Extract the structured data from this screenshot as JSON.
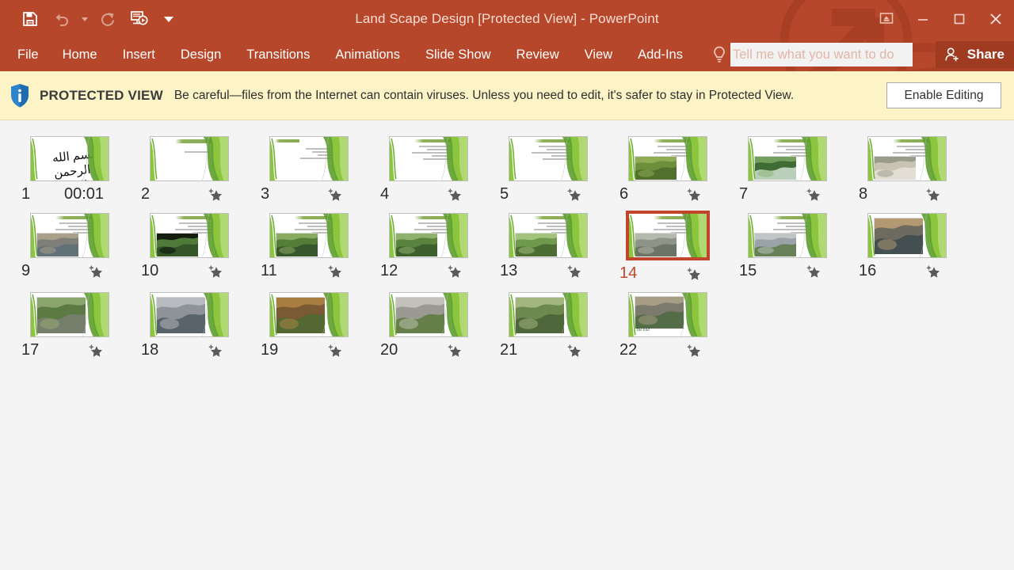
{
  "window": {
    "title": "Land Scape Design [Protected View] - PowerPoint",
    "titlebar_color": "#B7472A",
    "accent_color": "#C0452A"
  },
  "quick_access": {
    "items": [
      {
        "name": "save-icon",
        "label": "Save",
        "enabled": true
      },
      {
        "name": "undo-icon",
        "label": "Undo",
        "enabled": false
      },
      {
        "name": "redo-icon",
        "label": "Redo",
        "enabled": false
      },
      {
        "name": "start-from-beginning-icon",
        "label": "Start From Beginning",
        "enabled": true
      }
    ],
    "customize_label": "Customize Quick Access Toolbar"
  },
  "window_controls": {
    "ribbon_display_options": "Ribbon Display Options",
    "minimize": "Minimize",
    "restore": "Restore Down",
    "close": "Close"
  },
  "ribbon": {
    "tabs": [
      {
        "label": "File",
        "active": false
      },
      {
        "label": "Home",
        "active": false
      },
      {
        "label": "Insert",
        "active": false
      },
      {
        "label": "Design",
        "active": false
      },
      {
        "label": "Transitions",
        "active": false
      },
      {
        "label": "Animations",
        "active": false
      },
      {
        "label": "Slide Show",
        "active": false
      },
      {
        "label": "Review",
        "active": false
      },
      {
        "label": "View",
        "active": false
      },
      {
        "label": "Add-Ins",
        "active": false
      }
    ],
    "tell_me_placeholder": "Tell me what you want to do",
    "tell_me_value": "",
    "share_label": "Share"
  },
  "protected_view": {
    "title": "PROTECTED VIEW",
    "message": "Be careful—files from the Internet can contain viruses. Unless you need to edit, it's safer to stay in Protected View.",
    "button_label": "Enable Editing",
    "background_color": "#FCF4C6"
  },
  "slides": [
    {
      "number": "1",
      "time": "00:01",
      "animated": false,
      "selected": false,
      "kind": "calligraphy"
    },
    {
      "number": "2",
      "time": "",
      "animated": true,
      "selected": false,
      "kind": "title"
    },
    {
      "number": "3",
      "time": "",
      "animated": true,
      "selected": false,
      "kind": "text-left"
    },
    {
      "number": "4",
      "time": "",
      "animated": true,
      "selected": false,
      "kind": "text"
    },
    {
      "number": "5",
      "time": "",
      "animated": true,
      "selected": false,
      "kind": "text"
    },
    {
      "number": "6",
      "time": "",
      "animated": true,
      "selected": false,
      "kind": "text-photo",
      "photo": "bamboo"
    },
    {
      "number": "7",
      "time": "",
      "animated": true,
      "selected": false,
      "kind": "text-photo",
      "photo": "garden-path"
    },
    {
      "number": "8",
      "time": "",
      "animated": true,
      "selected": false,
      "kind": "text-photo",
      "photo": "pavilion"
    },
    {
      "number": "9",
      "time": "",
      "animated": true,
      "selected": false,
      "kind": "text-photo",
      "photo": "plaza"
    },
    {
      "number": "10",
      "time": "",
      "animated": true,
      "selected": false,
      "kind": "text-photo",
      "photo": "aerial-park"
    },
    {
      "number": "11",
      "time": "",
      "animated": true,
      "selected": false,
      "kind": "text-photo",
      "photo": "green-park"
    },
    {
      "number": "12",
      "time": "",
      "animated": true,
      "selected": false,
      "kind": "text-photo",
      "photo": "aerial-green"
    },
    {
      "number": "13",
      "time": "",
      "animated": true,
      "selected": false,
      "kind": "text-photo",
      "photo": "lawn"
    },
    {
      "number": "14",
      "time": "",
      "animated": true,
      "selected": true,
      "kind": "text-photo",
      "photo": "stone-wall"
    },
    {
      "number": "15",
      "time": "",
      "animated": true,
      "selected": false,
      "kind": "text-photo",
      "photo": "building"
    },
    {
      "number": "16",
      "time": "",
      "animated": true,
      "selected": false,
      "kind": "photo-full",
      "photo": "dusk-canal"
    },
    {
      "number": "17",
      "time": "",
      "animated": true,
      "selected": false,
      "kind": "photo-full",
      "photo": "aerial-paths"
    },
    {
      "number": "18",
      "time": "",
      "animated": true,
      "selected": false,
      "kind": "photo-full",
      "photo": "amphitheater"
    },
    {
      "number": "19",
      "time": "",
      "animated": true,
      "selected": false,
      "kind": "photo-full",
      "photo": "autumn-maze"
    },
    {
      "number": "20",
      "time": "",
      "animated": true,
      "selected": false,
      "kind": "photo-full",
      "photo": "steps-planting"
    },
    {
      "number": "21",
      "time": "",
      "animated": true,
      "selected": false,
      "kind": "photo-full",
      "photo": "aerial-terraces"
    },
    {
      "number": "22",
      "time": "",
      "animated": true,
      "selected": false,
      "kind": "photo-end",
      "photo": "courtyard",
      "caption": "The End"
    }
  ]
}
